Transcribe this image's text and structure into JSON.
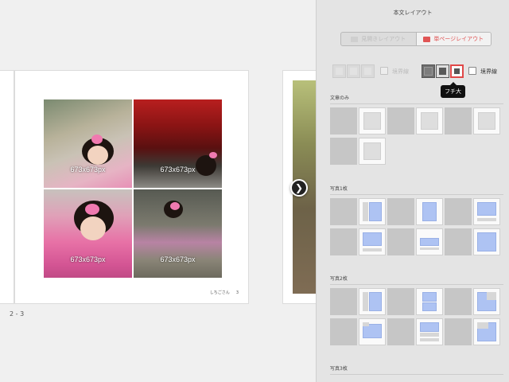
{
  "canvas": {
    "photos": [
      {
        "size_label": "673x673px"
      },
      {
        "size_label": "673x673px"
      },
      {
        "size_label": "673x673px"
      },
      {
        "size_label": "673x673px"
      }
    ],
    "page_caption": {
      "title": "しちごさん",
      "number": "3"
    },
    "spread_label": "2 - 3",
    "next_arrow_icon": "chevron-right-icon"
  },
  "panel": {
    "title": "本文レイアウト",
    "mode_toggle": {
      "spread_label": "見開きレイアウト",
      "single_label": "単ページレイアウト",
      "selected": "single"
    },
    "border_options": {
      "left_checkbox_label": "境界線",
      "right_checkbox_label": "境界線",
      "tooltip": "フチ大",
      "selected": "フチ大"
    },
    "sections": [
      {
        "title": "文章のみ"
      },
      {
        "title": "写真1枚"
      },
      {
        "title": "写真2枚"
      },
      {
        "title": "写真3枚"
      }
    ]
  },
  "colors": {
    "accent_red": "#e05555",
    "photo_blue": "#aec3f3",
    "panel_bg": "#e4e4e4"
  }
}
